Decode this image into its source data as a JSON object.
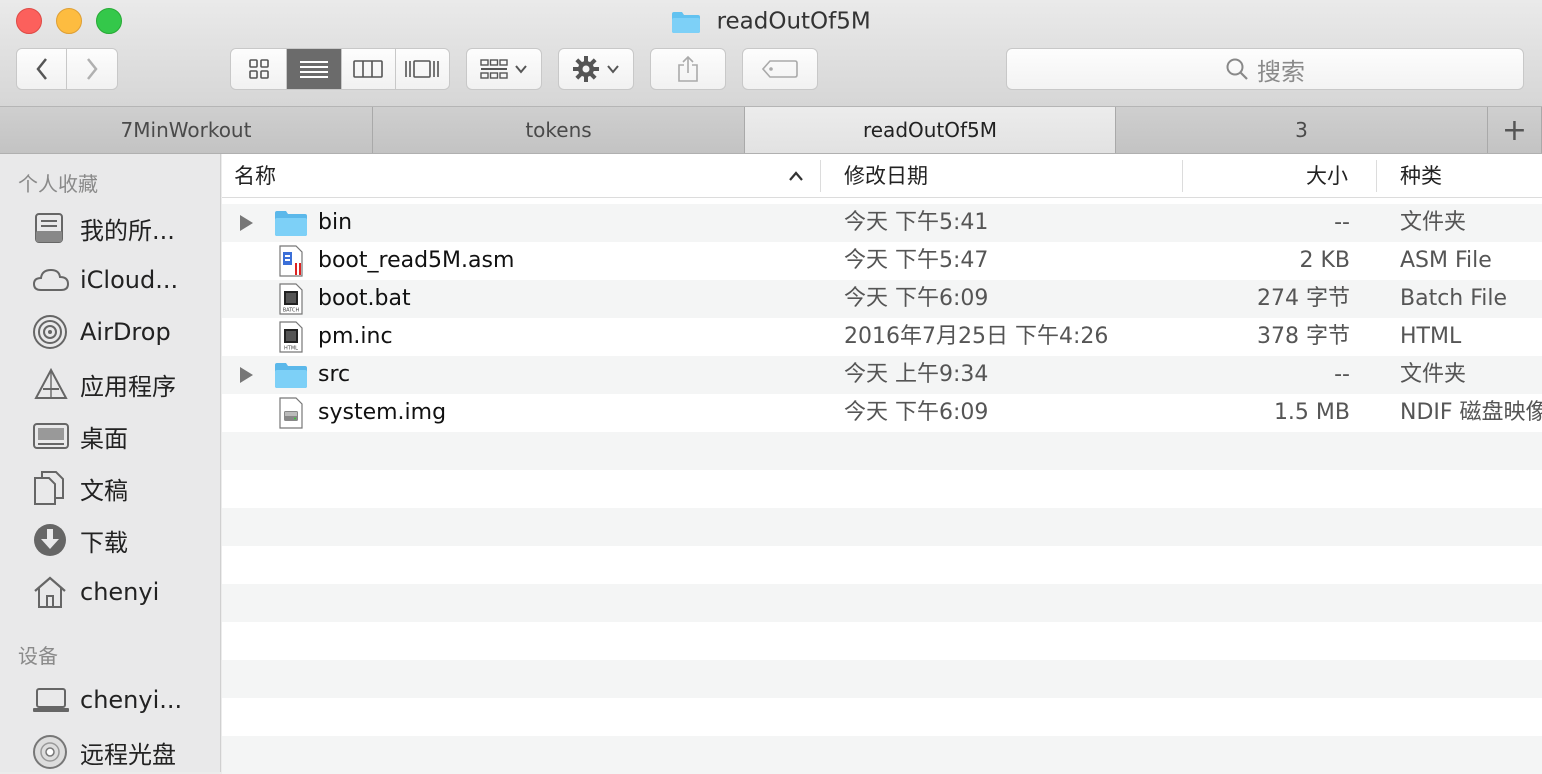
{
  "window": {
    "title": "readOutOf5M"
  },
  "toolbar": {
    "search_placeholder": "搜索"
  },
  "tabs": [
    {
      "label": "7MinWorkout"
    },
    {
      "label": "tokens"
    },
    {
      "label": "readOutOf5M"
    },
    {
      "label": "3"
    }
  ],
  "tab_add_label": "+",
  "sidebar": {
    "favorites_header": "个人收藏",
    "favorites": [
      {
        "label": "我的所...",
        "icon": "all-files-icon"
      },
      {
        "label": "iCloud...",
        "icon": "cloud-icon"
      },
      {
        "label": "AirDrop",
        "icon": "airdrop-icon"
      },
      {
        "label": "应用程序",
        "icon": "applications-icon"
      },
      {
        "label": "桌面",
        "icon": "desktop-icon"
      },
      {
        "label": "文稿",
        "icon": "documents-icon"
      },
      {
        "label": "下载",
        "icon": "download-icon"
      },
      {
        "label": "chenyi",
        "icon": "home-icon"
      }
    ],
    "devices_header": "设备",
    "devices": [
      {
        "label": "chenyi...",
        "icon": "laptop-icon"
      },
      {
        "label": "远程光盘",
        "icon": "disc-icon"
      }
    ]
  },
  "columns": {
    "name": "名称",
    "date": "修改日期",
    "size": "大小",
    "kind": "种类"
  },
  "files": [
    {
      "name": "bin",
      "date": "今天 下午5:41",
      "size": "--",
      "kind": "文件夹",
      "icon": "folder-icon",
      "expandable": true
    },
    {
      "name": "boot_read5M.asm",
      "date": "今天 下午5:47",
      "size": "2 KB",
      "kind": "ASM File",
      "icon": "asm-file-icon",
      "expandable": false
    },
    {
      "name": "boot.bat",
      "date": "今天 下午6:09",
      "size": "274 字节",
      "kind": "Batch File",
      "icon": "batch-file-icon",
      "badge": "BATCH",
      "expandable": false
    },
    {
      "name": "pm.inc",
      "date": "2016年7月25日 下午4:26",
      "size": "378 字节",
      "kind": "HTML",
      "icon": "html-file-icon",
      "badge": "HTML",
      "expandable": false
    },
    {
      "name": "src",
      "date": "今天 上午9:34",
      "size": "--",
      "kind": "文件夹",
      "icon": "folder-icon",
      "expandable": true
    },
    {
      "name": "system.img",
      "date": "今天 下午6:09",
      "size": "1.5 MB",
      "kind": "NDIF 磁盘映像",
      "icon": "disk-image-icon",
      "expandable": false
    }
  ],
  "colors": {
    "folder": "#62c2f0",
    "selected_view": "#6b6b6b"
  }
}
